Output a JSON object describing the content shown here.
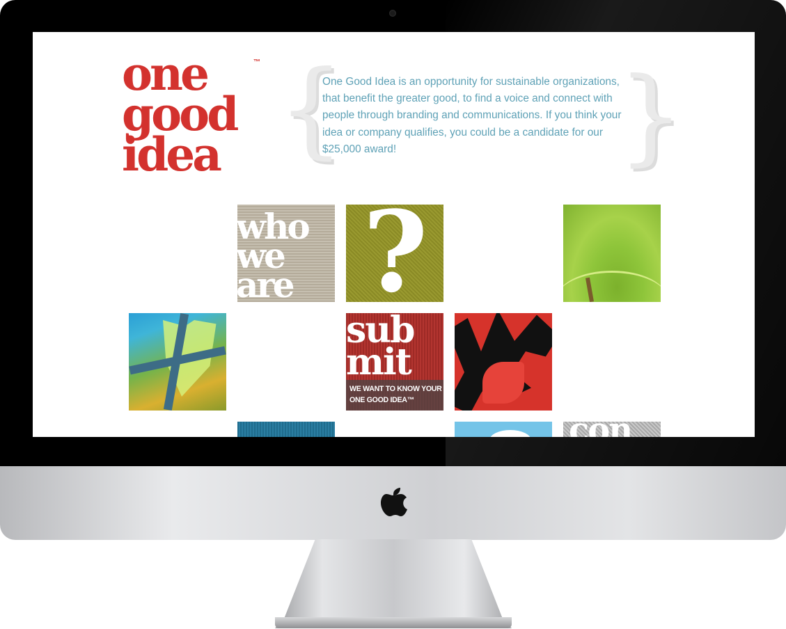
{
  "site": {
    "logo": {
      "line1": "one",
      "line2": "good",
      "line3": "idea",
      "trademark": "™"
    },
    "intro_text": "One Good Idea is an opportunity for sustainable organizations, that benefit the greater good, to find a voice and connect with people through branding and communications. If you think your idea or company qualifies, you could be a candidate for our $25,000 award!",
    "braces": {
      "left": "{",
      "right": "}"
    }
  },
  "tiles": {
    "who": {
      "lines": [
        "who",
        "we",
        "are"
      ]
    },
    "question": {
      "glyph": "?"
    },
    "submit": {
      "lines": [
        "sub",
        "mit"
      ],
      "caption_line1": "WE WANT TO KNOW YOUR",
      "caption_line2": "ONE GOOD IDEA™"
    },
    "contact": {
      "partial_text": "con"
    }
  },
  "device": {
    "logo_icon": "apple-logo-icon",
    "colors": {
      "logo_red": "#d3322e",
      "intro_blue": "#5ea1b6"
    }
  }
}
